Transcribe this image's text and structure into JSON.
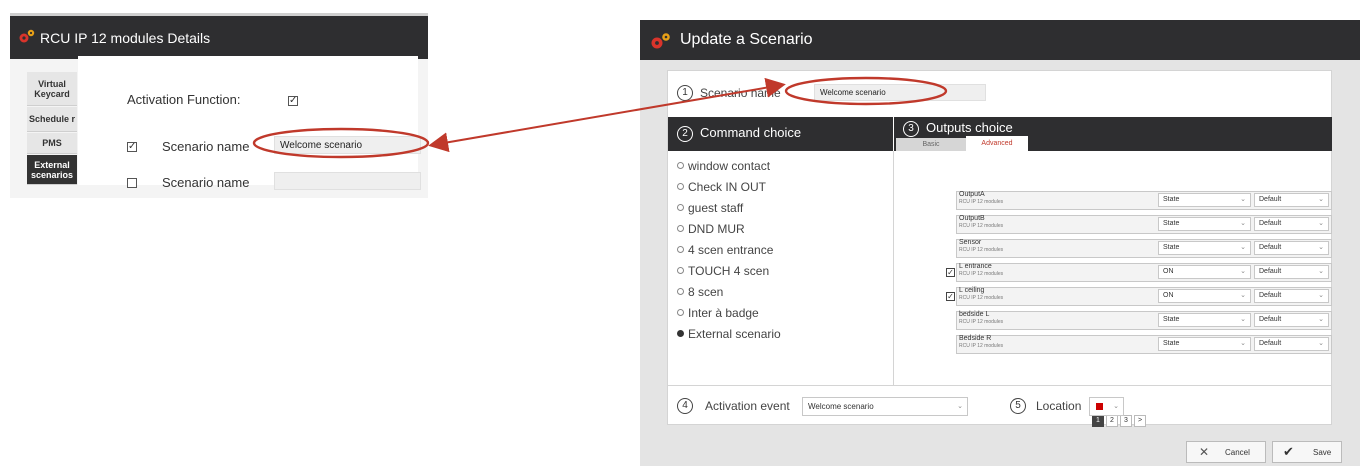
{
  "left": {
    "title": "RCU IP 12 modules Details",
    "tabs": [
      "Virtual Keycard",
      "Schedule r",
      "PMS",
      "External scenarios"
    ],
    "activation_label": "Activation Function:",
    "activation_checked": "✓",
    "rows": [
      {
        "checked": "✓",
        "label": "Scenario name",
        "value": "Welcome scenario"
      },
      {
        "checked": "",
        "label": "Scenario name",
        "value": ""
      }
    ]
  },
  "dialog": {
    "title": "Update a Scenario",
    "step1": {
      "num": "1",
      "label": "Scenario name",
      "value": "Welcome scenario"
    },
    "step2": {
      "num": "2",
      "label": "Command choice"
    },
    "step3": {
      "num": "3",
      "label": "Outputs choice"
    },
    "tabs": [
      "Basic",
      "Advanced"
    ],
    "commands": [
      {
        "label": "window contact",
        "selected": false
      },
      {
        "label": "Check IN OUT",
        "selected": false
      },
      {
        "label": "guest staff",
        "selected": false
      },
      {
        "label": "DND MUR",
        "selected": false
      },
      {
        "label": "4 scen entrance",
        "selected": false
      },
      {
        "label": "TOUCH 4 scen",
        "selected": false
      },
      {
        "label": "8 scen",
        "selected": false
      },
      {
        "label": "Inter à badge",
        "selected": false
      },
      {
        "label": "External scenario",
        "selected": true
      }
    ],
    "outputs": [
      {
        "name": "OutputA",
        "sub": "RCU IP 12 modules",
        "state": "State",
        "mode": "Default",
        "check": null
      },
      {
        "name": "OutputB",
        "sub": "RCU IP 12 modules",
        "state": "State",
        "mode": "Default",
        "check": null
      },
      {
        "name": "Sensor",
        "sub": "RCU IP 12 modules",
        "state": "State",
        "mode": "Default",
        "check": null
      },
      {
        "name": "L entrance",
        "sub": "RCU IP 12 modules",
        "state": "ON",
        "mode": "Default",
        "check": "✓"
      },
      {
        "name": "L ceiling",
        "sub": "RCU IP 12 modules",
        "state": "ON",
        "mode": "Default",
        "check": "✓"
      },
      {
        "name": "bedside L",
        "sub": "RCU IP 12 modules",
        "state": "State",
        "mode": "Default",
        "check": null
      },
      {
        "name": "Bedside R",
        "sub": "RCU IP 12 modules",
        "state": "State",
        "mode": "Default",
        "check": null
      }
    ],
    "pages": [
      "1",
      "2",
      "3",
      ">"
    ],
    "step4": {
      "num": "4",
      "label": "Activation event",
      "value": "Welcome scenario"
    },
    "step5": {
      "num": "5",
      "label": "Location"
    },
    "location_color": "#cc0000",
    "buttons": {
      "cancel": "Cancel",
      "save": "Save"
    }
  },
  "colors": {
    "titlebar": "#2e2e30",
    "highlight": "#c0392b",
    "accent_tab": "#c0392b"
  }
}
